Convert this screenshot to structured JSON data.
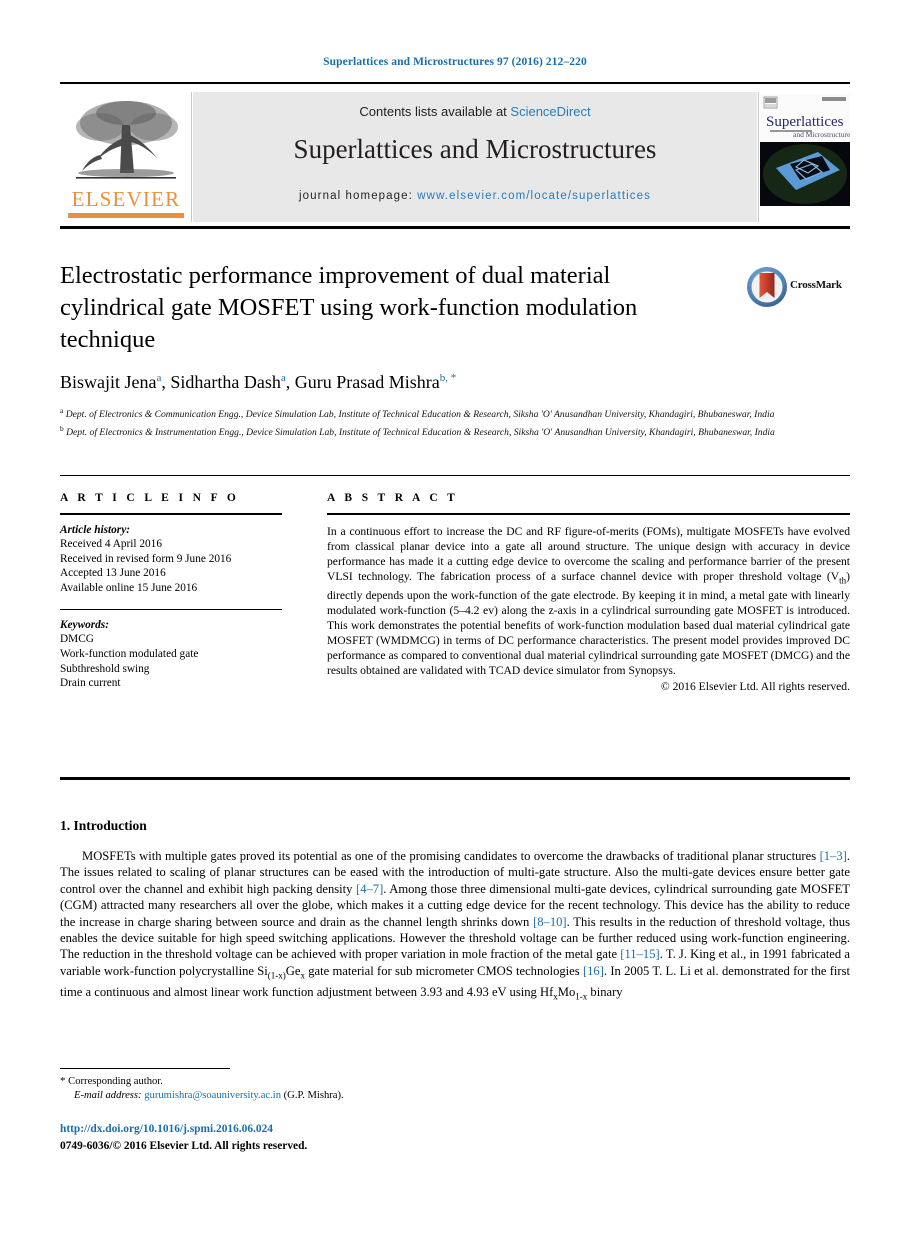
{
  "running_head": "Superlattices and Microstructures 97 (2016) 212–220",
  "masthead": {
    "publisher_name": "ELSEVIER",
    "publisher_logo_icon": "elsevier-tree-icon",
    "contents_prefix": "Contents lists available at ",
    "contents_link": "ScienceDirect",
    "journal_name": "Superlattices and Microstructures",
    "homepage_prefix": "journal homepage: ",
    "homepage_url": "www.elsevier.com/locate/superlattices",
    "cover_title_main": "Superlattices",
    "cover_title_sub": "and Microstructures"
  },
  "article": {
    "title": "Electrostatic performance improvement of dual material cylindrical gate MOSFET using work-function modulation technique",
    "crossmark_label": "CrossMark",
    "authors": [
      {
        "name": "Biswajit Jena",
        "marker": "a"
      },
      {
        "name": "Sidhartha Dash",
        "marker": "a"
      },
      {
        "name": "Guru Prasad Mishra",
        "marker": "b, *"
      }
    ],
    "affiliations": [
      {
        "marker": "a",
        "text": "Dept. of Electronics & Communication Engg., Device Simulation Lab, Institute of Technical Education & Research, Siksha 'O' Anusandhan University, Khandagiri, Bhubaneswar, India"
      },
      {
        "marker": "b",
        "text": "Dept. of Electronics & Instrumentation Engg., Device Simulation Lab, Institute of Technical Education & Research, Siksha 'O' Anusandhan University, Khandagiri, Bhubaneswar, India"
      }
    ]
  },
  "article_info": {
    "heading": "A R T I C L E   I N F O",
    "history_label": "Article history:",
    "history": [
      "Received 4 April 2016",
      "Received in revised form 9 June 2016",
      "Accepted 13 June 2016",
      "Available online 15 June 2016"
    ],
    "keywords_label": "Keywords:",
    "keywords": [
      "DMCG",
      "Work-function modulated gate",
      "Subthreshold swing",
      "Drain current"
    ]
  },
  "abstract": {
    "heading": "A B S T R A C T",
    "text": "In a continuous effort to increase the DC and RF figure-of-merits (FOMs), multigate MOSFETs have evolved from classical planar device into a gate all around structure. The unique design with accuracy in device performance has made it a cutting edge device to overcome the scaling and performance barrier of the present VLSI technology. The fabrication process of a surface channel device with proper threshold voltage (Vth) directly depends upon the work-function of the gate electrode. By keeping it in mind, a metal gate with linearly modulated work-function (5–4.2 ev) along the z-axis in a cylindrical surrounding gate MOSFET is introduced. This work demonstrates the potential benefits of work-function modulation based dual material cylindrical gate MOSFET (WMDMCG) in terms of DC performance characteristics. The present model provides improved DC performance as compared to conventional dual material cylindrical surrounding gate MOSFET (DMCG) and the results obtained are validated with TCAD device simulator from Synopsys.",
    "copyright": "© 2016 Elsevier Ltd. All rights reserved."
  },
  "section": {
    "number_title": "1.  Introduction",
    "paragraph": "MOSFETs with multiple gates proved its potential as one of the promising candidates to overcome the drawbacks of traditional planar structures [1–3]. The issues related to scaling of planar structures can be eased with the introduction of multi-gate structure. Also the multi-gate devices ensure better gate control over the channel and exhibit high packing density [4–7]. Among those three dimensional multi-gate devices, cylindrical surrounding gate MOSFET (CGM) attracted many researchers all over the globe, which makes it a cutting edge device for the recent technology. This device has the ability to reduce the increase in charge sharing between source and drain as the channel length shrinks down [8–10]. This results in the reduction of threshold voltage, thus enables the device suitable for high speed switching applications. However the threshold voltage can be further reduced using work-function engineering. The reduction in the threshold voltage can be achieved with proper variation in mole fraction of the metal gate [11–15]. T. J. King et al., in 1991 fabricated a variable work-function polycrystalline Si(1-x)Gex gate material for sub micrometer CMOS technologies [16]. In 2005 T. L. Li et al. demonstrated for the first time a continuous and almost linear work function adjustment between 3.93 and 4.93 eV using HfxMo1-x binary"
  },
  "footer": {
    "corresponding_marker": "*",
    "corresponding_label": "Corresponding author.",
    "email_label": "E-mail address:",
    "email": "gurumishra@soauniversity.ac.in",
    "email_owner": "(G.P. Mishra).",
    "doi": "http://dx.doi.org/10.1016/j.spmi.2016.06.024",
    "issn_line": "0749-6036/© 2016 Elsevier Ltd. All rights reserved."
  },
  "colors": {
    "link_blue": "#1a6ea8",
    "sciencedirect_blue": "#2b7bb9",
    "elsevier_orange": "#E8913A",
    "masthead_grey": "#e8e8e8",
    "crossmark_blue": "#4e81b4",
    "crossmark_red": "#c0392b"
  }
}
